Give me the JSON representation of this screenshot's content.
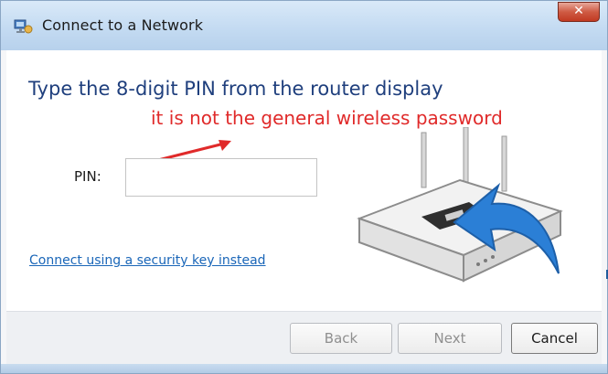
{
  "window": {
    "title": "Connect to a Network",
    "close_glyph": "✕"
  },
  "main": {
    "heading": "Type the 8-digit PIN from the router display",
    "annotation": "it is not the general wireless password",
    "pin_label": "PIN:",
    "pin_value": "",
    "alt_link": "Connect using a security key instead"
  },
  "footer": {
    "back_label": "Back",
    "next_label": "Next",
    "cancel_label": "Cancel"
  },
  "icons": {
    "title_icon": "network-icon",
    "illustration": "router-icon",
    "arrow": "arrow-icon"
  },
  "colors": {
    "heading": "#1f3f7d",
    "annotation": "#e02a2a",
    "link": "#1a66b8",
    "arrow_blue": "#2b7fd6"
  }
}
